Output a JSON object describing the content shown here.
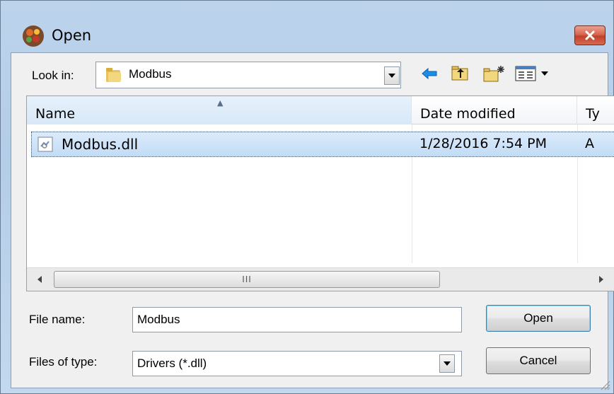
{
  "window": {
    "title": "Open"
  },
  "lookin": {
    "label": "Look in:",
    "value": "Modbus"
  },
  "toolbar": {
    "back_icon": "back-arrow-icon",
    "up_icon": "up-folder-icon",
    "new_folder_icon": "new-folder-icon",
    "view_menu_icon": "view-menu-icon"
  },
  "list": {
    "columns": [
      "Name",
      "Date modified",
      "Ty"
    ],
    "rows": [
      {
        "name": "Modbus.dll",
        "date": "1/28/2016 7:54 PM",
        "type": "A"
      }
    ],
    "scroll_thumb_text": "III"
  },
  "filename": {
    "label": "File name:",
    "value": "Modbus"
  },
  "filetype": {
    "label": "Files of type:",
    "value": "Drivers (*.dll)"
  },
  "buttons": {
    "open": "Open",
    "cancel": "Cancel"
  }
}
